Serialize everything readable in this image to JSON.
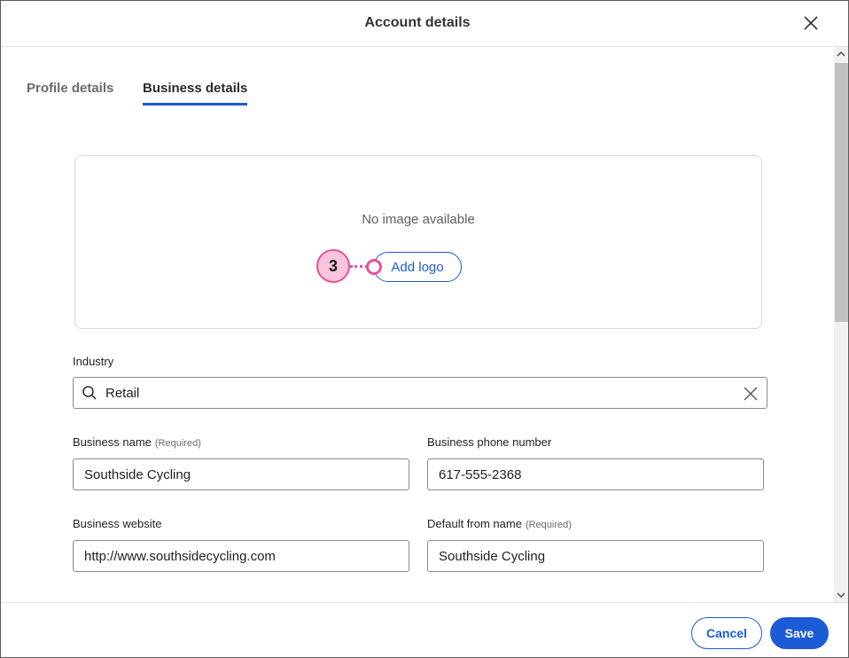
{
  "dialog": {
    "title": "Account details",
    "close_icon": "close-icon"
  },
  "tabs": [
    {
      "label": "Profile details",
      "active": false
    },
    {
      "label": "Business details",
      "active": true
    }
  ],
  "logo": {
    "empty_text": "No image available",
    "add_label": "Add logo",
    "callout_number": "3"
  },
  "industry": {
    "label": "Industry",
    "value": "Retail",
    "icon": "search-icon",
    "clear_icon": "clear-icon"
  },
  "business_name": {
    "label": "Business name",
    "required": "(Required)",
    "value": "Southside Cycling"
  },
  "business_phone": {
    "label": "Business phone number",
    "value": "617-555-2368"
  },
  "business_website": {
    "label": "Business website",
    "value": "http://www.southsidecycling.com"
  },
  "default_from_name": {
    "label": "Default from name",
    "required": "(Required)",
    "value": "Southside Cycling"
  },
  "footer": {
    "cancel_label": "Cancel",
    "save_label": "Save"
  },
  "colors": {
    "accent": "#1c5bd6",
    "callout": "#e6529a",
    "callout_fill": "#f9c4dc"
  }
}
